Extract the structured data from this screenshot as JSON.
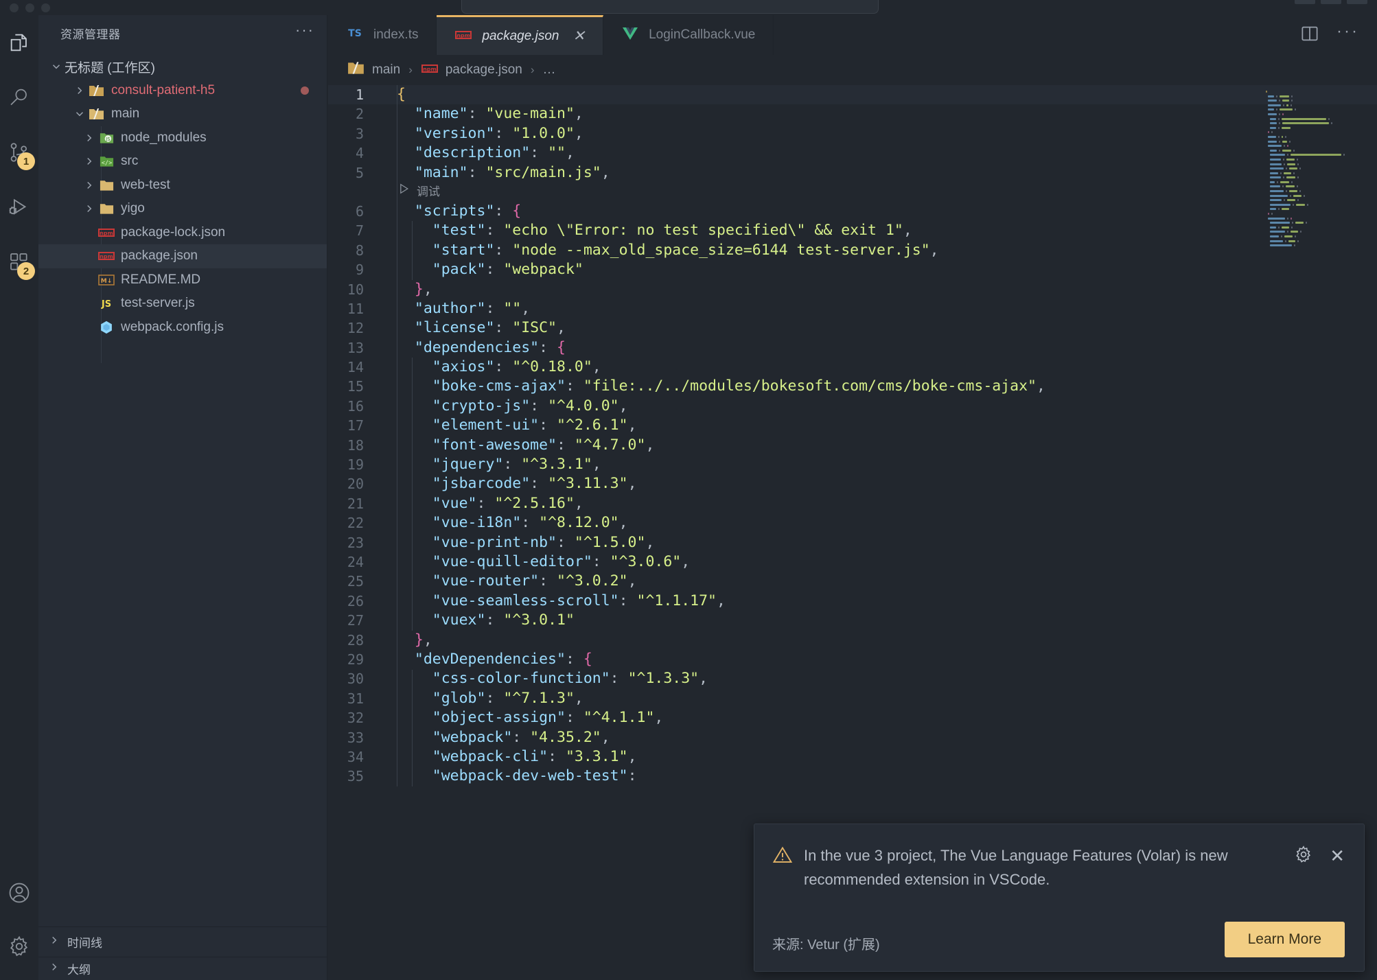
{
  "window": {
    "traffic_lights": [
      "close",
      "minimize",
      "zoom"
    ]
  },
  "activity_bar": {
    "items": [
      {
        "name": "explorer",
        "icon": "files-icon",
        "badge": null,
        "active": true
      },
      {
        "name": "search",
        "icon": "search-icon",
        "badge": null,
        "active": false
      },
      {
        "name": "source-control",
        "icon": "source-control-icon",
        "badge": "1",
        "active": false
      },
      {
        "name": "run-and-debug",
        "icon": "debug-icon",
        "badge": null,
        "active": false
      },
      {
        "name": "extensions",
        "icon": "extensions-icon",
        "badge": "2",
        "active": false
      }
    ],
    "bottom_items": [
      {
        "name": "accounts",
        "icon": "account-icon"
      },
      {
        "name": "manage",
        "icon": "gear-icon"
      }
    ]
  },
  "sidebar": {
    "title": "资源管理器",
    "more_actions": "···",
    "workspace": {
      "label": "无标题 (工作区)",
      "expanded": true
    },
    "tree": [
      {
        "label": "consult-patient-h5",
        "icon": "folder-open-icon",
        "depth": 1,
        "expandable": true,
        "expanded": false,
        "color": "#e06c75",
        "modified": true
      },
      {
        "label": "main",
        "icon": "folder-open-icon",
        "depth": 1,
        "expandable": true,
        "expanded": true,
        "color": "#a9b1bd",
        "modified": false
      },
      {
        "label": "node_modules",
        "icon": "nodejs-icon",
        "depth": 2,
        "expandable": true,
        "expanded": false,
        "color": "#a9b1bd",
        "modified": false
      },
      {
        "label": "src",
        "icon": "src-folder-icon",
        "depth": 2,
        "expandable": true,
        "expanded": false,
        "color": "#a9b1bd",
        "modified": false
      },
      {
        "label": "web-test",
        "icon": "folder-icon",
        "depth": 2,
        "expandable": true,
        "expanded": false,
        "color": "#a9b1bd",
        "modified": false
      },
      {
        "label": "yigo",
        "icon": "folder-icon",
        "depth": 2,
        "expandable": true,
        "expanded": false,
        "color": "#a9b1bd",
        "modified": false
      },
      {
        "label": "package-lock.json",
        "icon": "npm-icon",
        "depth": 2,
        "expandable": false,
        "expanded": false,
        "color": "#a9b1bd",
        "modified": false
      },
      {
        "label": "package.json",
        "icon": "npm-icon",
        "depth": 2,
        "expandable": false,
        "expanded": false,
        "color": "#a9b1bd",
        "modified": false,
        "selected": true
      },
      {
        "label": "README.MD",
        "icon": "markdown-icon",
        "depth": 2,
        "expandable": false,
        "expanded": false,
        "color": "#a9b1bd",
        "modified": false
      },
      {
        "label": "test-server.js",
        "icon": "js-icon",
        "depth": 2,
        "expandable": false,
        "expanded": false,
        "color": "#a9b1bd",
        "modified": false
      },
      {
        "label": "webpack.config.js",
        "icon": "webpack-icon",
        "depth": 2,
        "expandable": false,
        "expanded": false,
        "color": "#a9b1bd",
        "modified": false
      }
    ],
    "bottom_sections": [
      {
        "label": "时间线",
        "expanded": false
      },
      {
        "label": "大纲",
        "expanded": false
      }
    ]
  },
  "editor": {
    "tabs": [
      {
        "label": "index.ts",
        "icon": "typescript-icon",
        "active": false,
        "closable": false
      },
      {
        "label": "package.json",
        "icon": "npm-icon",
        "active": true,
        "closable": true,
        "close_glyph": "✕"
      },
      {
        "label": "LoginCallback.vue",
        "icon": "vue-icon",
        "active": false,
        "closable": false
      }
    ],
    "actions": [
      {
        "name": "split-editor",
        "icon": "split-editor-icon"
      },
      {
        "name": "more-actions",
        "icon": "ellipsis-icon",
        "glyph": "···"
      }
    ],
    "breadcrumb": [
      {
        "label": "main",
        "icon": "folder-open-icon"
      },
      {
        "label": "package.json",
        "icon": "npm-icon"
      },
      {
        "label": "…",
        "icon": null
      }
    ],
    "breadcrumb_separator": "›",
    "codelens": {
      "label": "调试",
      "icon": "play-icon",
      "after_line": 5
    },
    "accent_color": "#e8b563",
    "lines": [
      {
        "n": 1,
        "tokens": [
          {
            "t": "{",
            "c": "b1"
          }
        ],
        "current": true
      },
      {
        "n": 2,
        "tokens": [
          {
            "t": "  ",
            "c": "p"
          },
          {
            "t": "\"name\"",
            "c": "k"
          },
          {
            "t": ": ",
            "c": "p"
          },
          {
            "t": "\"vue-main\"",
            "c": "s"
          },
          {
            "t": ",",
            "c": "p"
          }
        ]
      },
      {
        "n": 3,
        "tokens": [
          {
            "t": "  ",
            "c": "p"
          },
          {
            "t": "\"version\"",
            "c": "k"
          },
          {
            "t": ": ",
            "c": "p"
          },
          {
            "t": "\"1.0.0\"",
            "c": "s"
          },
          {
            "t": ",",
            "c": "p"
          }
        ]
      },
      {
        "n": 4,
        "tokens": [
          {
            "t": "  ",
            "c": "p"
          },
          {
            "t": "\"description\"",
            "c": "k"
          },
          {
            "t": ": ",
            "c": "p"
          },
          {
            "t": "\"\"",
            "c": "s"
          },
          {
            "t": ",",
            "c": "p"
          }
        ]
      },
      {
        "n": 5,
        "tokens": [
          {
            "t": "  ",
            "c": "p"
          },
          {
            "t": "\"main\"",
            "c": "k"
          },
          {
            "t": ": ",
            "c": "p"
          },
          {
            "t": "\"src/main.js\"",
            "c": "s"
          },
          {
            "t": ",",
            "c": "p"
          }
        ]
      },
      {
        "n": 6,
        "tokens": [
          {
            "t": "  ",
            "c": "p"
          },
          {
            "t": "\"scripts\"",
            "c": "k"
          },
          {
            "t": ": ",
            "c": "p"
          },
          {
            "t": "{",
            "c": "b2"
          }
        ]
      },
      {
        "n": 7,
        "tokens": [
          {
            "t": "    ",
            "c": "p"
          },
          {
            "t": "\"test\"",
            "c": "k"
          },
          {
            "t": ": ",
            "c": "p"
          },
          {
            "t": "\"echo \\\"Error: no test specified\\\" && exit 1\"",
            "c": "s"
          },
          {
            "t": ",",
            "c": "p"
          }
        ]
      },
      {
        "n": 8,
        "tokens": [
          {
            "t": "    ",
            "c": "p"
          },
          {
            "t": "\"start\"",
            "c": "k"
          },
          {
            "t": ": ",
            "c": "p"
          },
          {
            "t": "\"node --max_old_space_size=6144 test-server.js\"",
            "c": "s"
          },
          {
            "t": ",",
            "c": "p"
          }
        ]
      },
      {
        "n": 9,
        "tokens": [
          {
            "t": "    ",
            "c": "p"
          },
          {
            "t": "\"pack\"",
            "c": "k"
          },
          {
            "t": ": ",
            "c": "p"
          },
          {
            "t": "\"webpack\"",
            "c": "s"
          }
        ]
      },
      {
        "n": 10,
        "tokens": [
          {
            "t": "  ",
            "c": "p"
          },
          {
            "t": "}",
            "c": "b2"
          },
          {
            "t": ",",
            "c": "p"
          }
        ]
      },
      {
        "n": 11,
        "tokens": [
          {
            "t": "  ",
            "c": "p"
          },
          {
            "t": "\"author\"",
            "c": "k"
          },
          {
            "t": ": ",
            "c": "p"
          },
          {
            "t": "\"\"",
            "c": "s"
          },
          {
            "t": ",",
            "c": "p"
          }
        ]
      },
      {
        "n": 12,
        "tokens": [
          {
            "t": "  ",
            "c": "p"
          },
          {
            "t": "\"license\"",
            "c": "k"
          },
          {
            "t": ": ",
            "c": "p"
          },
          {
            "t": "\"ISC\"",
            "c": "s"
          },
          {
            "t": ",",
            "c": "p"
          }
        ]
      },
      {
        "n": 13,
        "tokens": [
          {
            "t": "  ",
            "c": "p"
          },
          {
            "t": "\"dependencies\"",
            "c": "k"
          },
          {
            "t": ": ",
            "c": "p"
          },
          {
            "t": "{",
            "c": "b2"
          }
        ]
      },
      {
        "n": 14,
        "tokens": [
          {
            "t": "    ",
            "c": "p"
          },
          {
            "t": "\"axios\"",
            "c": "k"
          },
          {
            "t": ": ",
            "c": "p"
          },
          {
            "t": "\"^0.18.0\"",
            "c": "s"
          },
          {
            "t": ",",
            "c": "p"
          }
        ]
      },
      {
        "n": 15,
        "tokens": [
          {
            "t": "    ",
            "c": "p"
          },
          {
            "t": "\"boke-cms-ajax\"",
            "c": "k"
          },
          {
            "t": ": ",
            "c": "p"
          },
          {
            "t": "\"file:../../modules/bokesoft.com/cms/boke-cms-ajax\"",
            "c": "s"
          },
          {
            "t": ",",
            "c": "p"
          }
        ]
      },
      {
        "n": 16,
        "tokens": [
          {
            "t": "    ",
            "c": "p"
          },
          {
            "t": "\"crypto-js\"",
            "c": "k"
          },
          {
            "t": ": ",
            "c": "p"
          },
          {
            "t": "\"^4.0.0\"",
            "c": "s"
          },
          {
            "t": ",",
            "c": "p"
          }
        ]
      },
      {
        "n": 17,
        "tokens": [
          {
            "t": "    ",
            "c": "p"
          },
          {
            "t": "\"element-ui\"",
            "c": "k"
          },
          {
            "t": ": ",
            "c": "p"
          },
          {
            "t": "\"^2.6.1\"",
            "c": "s"
          },
          {
            "t": ",",
            "c": "p"
          }
        ]
      },
      {
        "n": 18,
        "tokens": [
          {
            "t": "    ",
            "c": "p"
          },
          {
            "t": "\"font-awesome\"",
            "c": "k"
          },
          {
            "t": ": ",
            "c": "p"
          },
          {
            "t": "\"^4.7.0\"",
            "c": "s"
          },
          {
            "t": ",",
            "c": "p"
          }
        ]
      },
      {
        "n": 19,
        "tokens": [
          {
            "t": "    ",
            "c": "p"
          },
          {
            "t": "\"jquery\"",
            "c": "k"
          },
          {
            "t": ": ",
            "c": "p"
          },
          {
            "t": "\"^3.3.1\"",
            "c": "s"
          },
          {
            "t": ",",
            "c": "p"
          }
        ]
      },
      {
        "n": 20,
        "tokens": [
          {
            "t": "    ",
            "c": "p"
          },
          {
            "t": "\"jsbarcode\"",
            "c": "k"
          },
          {
            "t": ": ",
            "c": "p"
          },
          {
            "t": "\"^3.11.3\"",
            "c": "s"
          },
          {
            "t": ",",
            "c": "p"
          }
        ]
      },
      {
        "n": 21,
        "tokens": [
          {
            "t": "    ",
            "c": "p"
          },
          {
            "t": "\"vue\"",
            "c": "k"
          },
          {
            "t": ": ",
            "c": "p"
          },
          {
            "t": "\"^2.5.16\"",
            "c": "s"
          },
          {
            "t": ",",
            "c": "p"
          }
        ]
      },
      {
        "n": 22,
        "tokens": [
          {
            "t": "    ",
            "c": "p"
          },
          {
            "t": "\"vue-i18n\"",
            "c": "k"
          },
          {
            "t": ": ",
            "c": "p"
          },
          {
            "t": "\"^8.12.0\"",
            "c": "s"
          },
          {
            "t": ",",
            "c": "p"
          }
        ]
      },
      {
        "n": 23,
        "tokens": [
          {
            "t": "    ",
            "c": "p"
          },
          {
            "t": "\"vue-print-nb\"",
            "c": "k"
          },
          {
            "t": ": ",
            "c": "p"
          },
          {
            "t": "\"^1.5.0\"",
            "c": "s"
          },
          {
            "t": ",",
            "c": "p"
          }
        ]
      },
      {
        "n": 24,
        "tokens": [
          {
            "t": "    ",
            "c": "p"
          },
          {
            "t": "\"vue-quill-editor\"",
            "c": "k"
          },
          {
            "t": ": ",
            "c": "p"
          },
          {
            "t": "\"^3.0.6\"",
            "c": "s"
          },
          {
            "t": ",",
            "c": "p"
          }
        ]
      },
      {
        "n": 25,
        "tokens": [
          {
            "t": "    ",
            "c": "p"
          },
          {
            "t": "\"vue-router\"",
            "c": "k"
          },
          {
            "t": ": ",
            "c": "p"
          },
          {
            "t": "\"^3.0.2\"",
            "c": "s"
          },
          {
            "t": ",",
            "c": "p"
          }
        ]
      },
      {
        "n": 26,
        "tokens": [
          {
            "t": "    ",
            "c": "p"
          },
          {
            "t": "\"vue-seamless-scroll\"",
            "c": "k"
          },
          {
            "t": ": ",
            "c": "p"
          },
          {
            "t": "\"^1.1.17\"",
            "c": "s"
          },
          {
            "t": ",",
            "c": "p"
          }
        ]
      },
      {
        "n": 27,
        "tokens": [
          {
            "t": "    ",
            "c": "p"
          },
          {
            "t": "\"vuex\"",
            "c": "k"
          },
          {
            "t": ": ",
            "c": "p"
          },
          {
            "t": "\"^3.0.1\"",
            "c": "s"
          }
        ]
      },
      {
        "n": 28,
        "tokens": [
          {
            "t": "  ",
            "c": "p"
          },
          {
            "t": "}",
            "c": "b2"
          },
          {
            "t": ",",
            "c": "p"
          }
        ]
      },
      {
        "n": 29,
        "tokens": [
          {
            "t": "  ",
            "c": "p"
          },
          {
            "t": "\"devDependencies\"",
            "c": "k"
          },
          {
            "t": ": ",
            "c": "p"
          },
          {
            "t": "{",
            "c": "b2"
          }
        ]
      },
      {
        "n": 30,
        "tokens": [
          {
            "t": "    ",
            "c": "p"
          },
          {
            "t": "\"css-color-function\"",
            "c": "k"
          },
          {
            "t": ": ",
            "c": "p"
          },
          {
            "t": "\"^1.3.3\"",
            "c": "s"
          },
          {
            "t": ",",
            "c": "p"
          }
        ]
      },
      {
        "n": 31,
        "tokens": [
          {
            "t": "    ",
            "c": "p"
          },
          {
            "t": "\"glob\"",
            "c": "k"
          },
          {
            "t": ": ",
            "c": "p"
          },
          {
            "t": "\"^7.1.3\"",
            "c": "s"
          },
          {
            "t": ",",
            "c": "p"
          }
        ]
      },
      {
        "n": 32,
        "tokens": [
          {
            "t": "    ",
            "c": "p"
          },
          {
            "t": "\"object-assign\"",
            "c": "k"
          },
          {
            "t": ": ",
            "c": "p"
          },
          {
            "t": "\"^4.1.1\"",
            "c": "s"
          },
          {
            "t": ",",
            "c": "p"
          }
        ]
      },
      {
        "n": 33,
        "tokens": [
          {
            "t": "    ",
            "c": "p"
          },
          {
            "t": "\"webpack\"",
            "c": "k"
          },
          {
            "t": ": ",
            "c": "p"
          },
          {
            "t": "\"4.35.2\"",
            "c": "s"
          },
          {
            "t": ",",
            "c": "p"
          }
        ]
      },
      {
        "n": 34,
        "tokens": [
          {
            "t": "    ",
            "c": "p"
          },
          {
            "t": "\"webpack-cli\"",
            "c": "k"
          },
          {
            "t": ": ",
            "c": "p"
          },
          {
            "t": "\"3.3.1\"",
            "c": "s"
          },
          {
            "t": ",",
            "c": "p"
          }
        ]
      },
      {
        "n": 35,
        "tokens": [
          {
            "t": "    ",
            "c": "p"
          },
          {
            "t": "\"webpack-dev-web-test\"",
            "c": "k"
          },
          {
            "t": ": ",
            "c": "p"
          }
        ]
      }
    ]
  },
  "notification": {
    "icon": "warning-icon",
    "message": "In the vue 3 project, The Vue Language Features (Volar) is new recommended extension in VSCode.",
    "source": "来源: Vetur (扩展)",
    "primary_button": "Learn More",
    "gear_icon": "gear-icon",
    "close_icon": "close-icon",
    "close_glyph": "✕",
    "accent_color": "#f2ce84"
  }
}
